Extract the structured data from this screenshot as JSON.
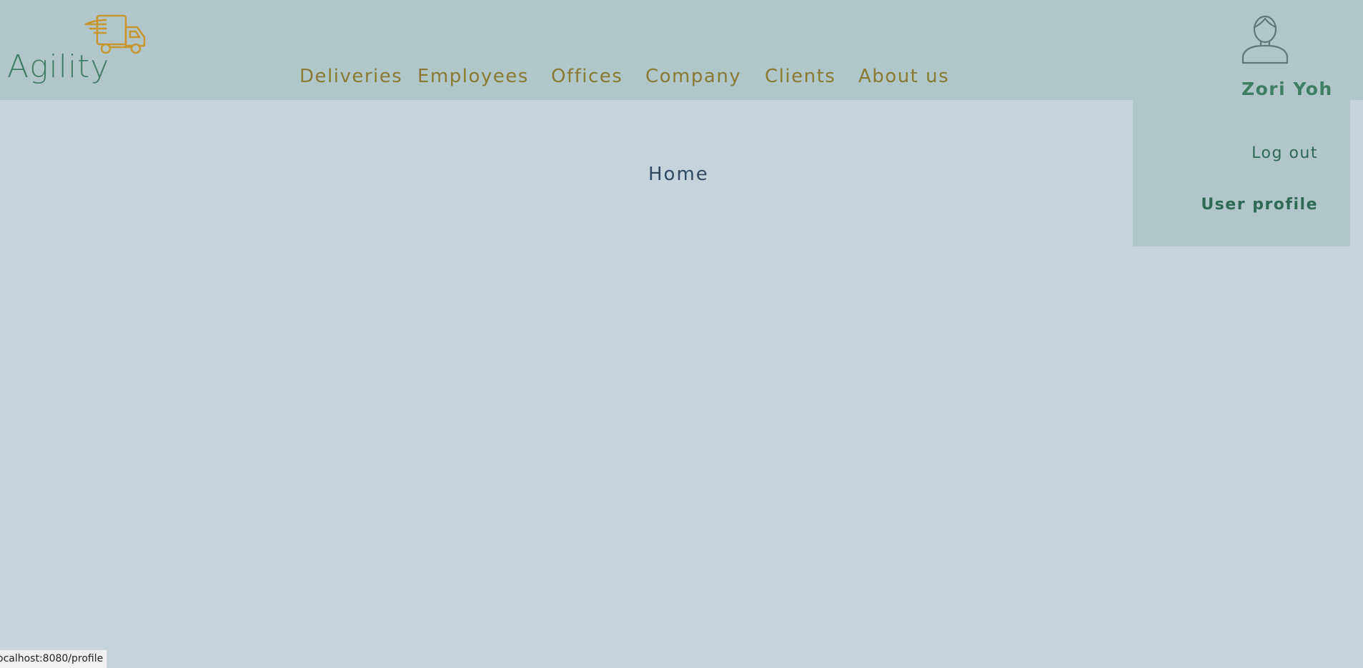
{
  "app": {
    "logo_text": "Agility"
  },
  "nav": {
    "items": [
      {
        "label": "Deliveries"
      },
      {
        "label": "Employees"
      },
      {
        "label": "Offices"
      },
      {
        "label": "Company"
      },
      {
        "label": "Clients"
      },
      {
        "label": "About us"
      }
    ]
  },
  "user": {
    "name": "Zori Yoh",
    "avatar_icon": "user-icon"
  },
  "dropdown": {
    "logout_label": "Log out",
    "profile_label": "User profile"
  },
  "main": {
    "title": "Home"
  },
  "status_bar": {
    "url": "ocalhost:8080/profile"
  },
  "colors": {
    "header_bg": "#b0c6c8",
    "page_bg": "#c5d3db",
    "nav_text": "#8a7a33",
    "brand_green": "#3e7e63",
    "logo_truck": "#c8962e",
    "title_text": "#2d4a62"
  }
}
